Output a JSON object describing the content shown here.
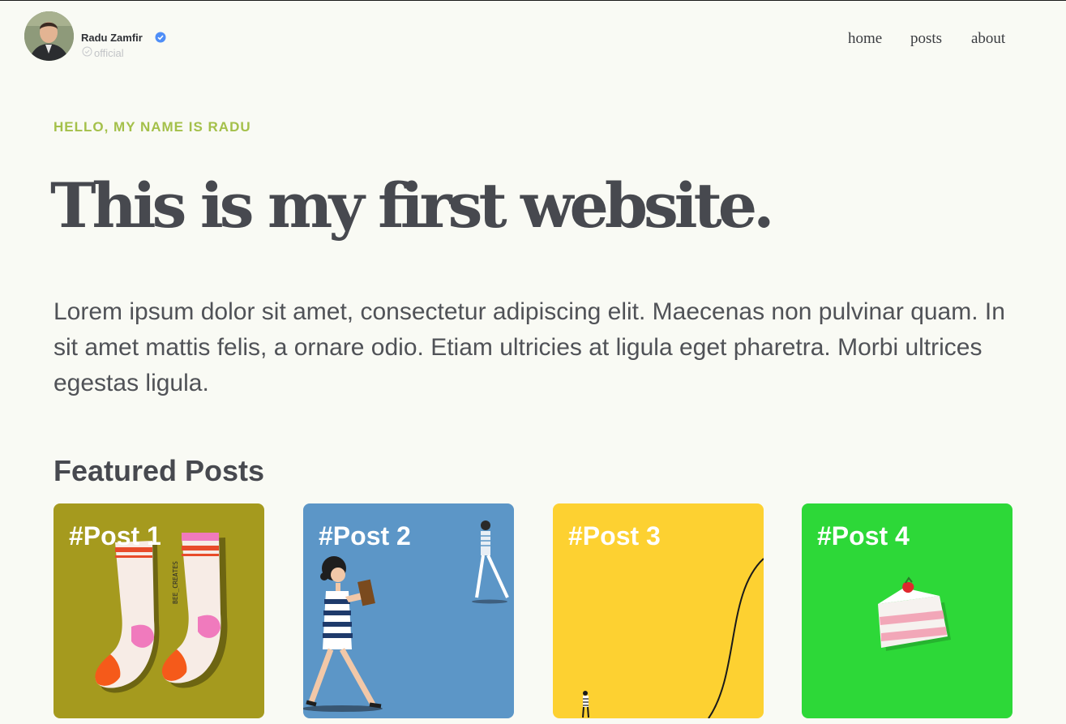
{
  "header": {
    "author_name": "Radu Zamfir",
    "author_tag": "official",
    "avatar_icon": "avatar-photo",
    "verified_icon": "verified-badge-icon",
    "official_icon": "check-circle-icon"
  },
  "nav": {
    "items": [
      {
        "label": "home"
      },
      {
        "label": "posts"
      },
      {
        "label": "about"
      }
    ]
  },
  "hero": {
    "eyebrow": "HELLO, MY NAME IS RADU",
    "title": "This is my first website.",
    "intro": "Lorem ipsum dolor sit amet, consectetur adipiscing elit. Maecenas non pulvinar quam. In sit amet mattis felis, a ornare odio. Etiam ultricies at ligula eget pharetra. Morbi ultrices egestas ligula."
  },
  "featured": {
    "heading": "Featured Posts",
    "posts": [
      {
        "title": "#Post 1",
        "color": "#a59a1e",
        "art": "socks-illustration",
        "art_text": "BEE_CREATES"
      },
      {
        "title": "#Post 2",
        "color": "#5c96c7",
        "art": "walking-reader-illustration"
      },
      {
        "title": "#Post 3",
        "color": "#fdd131",
        "art": "curve-illustration"
      },
      {
        "title": "#Post 4",
        "color": "#2dd838",
        "art": "cake-slice-illustration"
      }
    ]
  },
  "colors": {
    "background": "#f9faf4",
    "accent": "#a4c04a",
    "text": "#47494f",
    "verified": "#4f8ef7"
  }
}
